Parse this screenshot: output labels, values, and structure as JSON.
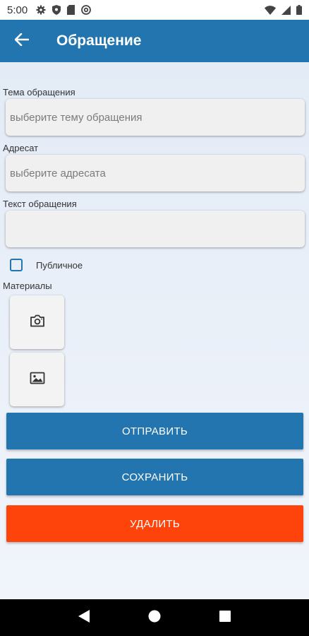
{
  "status_bar": {
    "time": "5:00",
    "left_icons": [
      "gear-icon",
      "shield-icon",
      "sd-card-icon",
      "at-sign-icon"
    ],
    "right_icons": [
      "wifi-icon",
      "signal-icon",
      "battery-icon"
    ]
  },
  "app_bar": {
    "title": "Обращение",
    "back_icon": "arrow-left-icon"
  },
  "form": {
    "topic": {
      "label": "Тема обращения",
      "placeholder": "выберите тему обращения",
      "value": ""
    },
    "addressee": {
      "label": "Адресат",
      "placeholder": "выберите адресата",
      "value": ""
    },
    "text": {
      "label": "Текст обращения",
      "value": ""
    },
    "public": {
      "label": "Публичное",
      "checked": false
    },
    "materials": {
      "label": "Материалы",
      "tiles": [
        {
          "icon": "camera-icon"
        },
        {
          "icon": "image-icon"
        }
      ]
    }
  },
  "actions": {
    "send": "ОТПРАВИТЬ",
    "save": "СОХРАНИТЬ",
    "delete": "УДАЛИТЬ"
  },
  "colors": {
    "primary": "#2275ae",
    "danger": "#fe440a",
    "background": "#eaf0f8"
  },
  "nav_bar": {
    "buttons": [
      "back-triangle-icon",
      "home-circle-icon",
      "recents-square-icon"
    ]
  }
}
